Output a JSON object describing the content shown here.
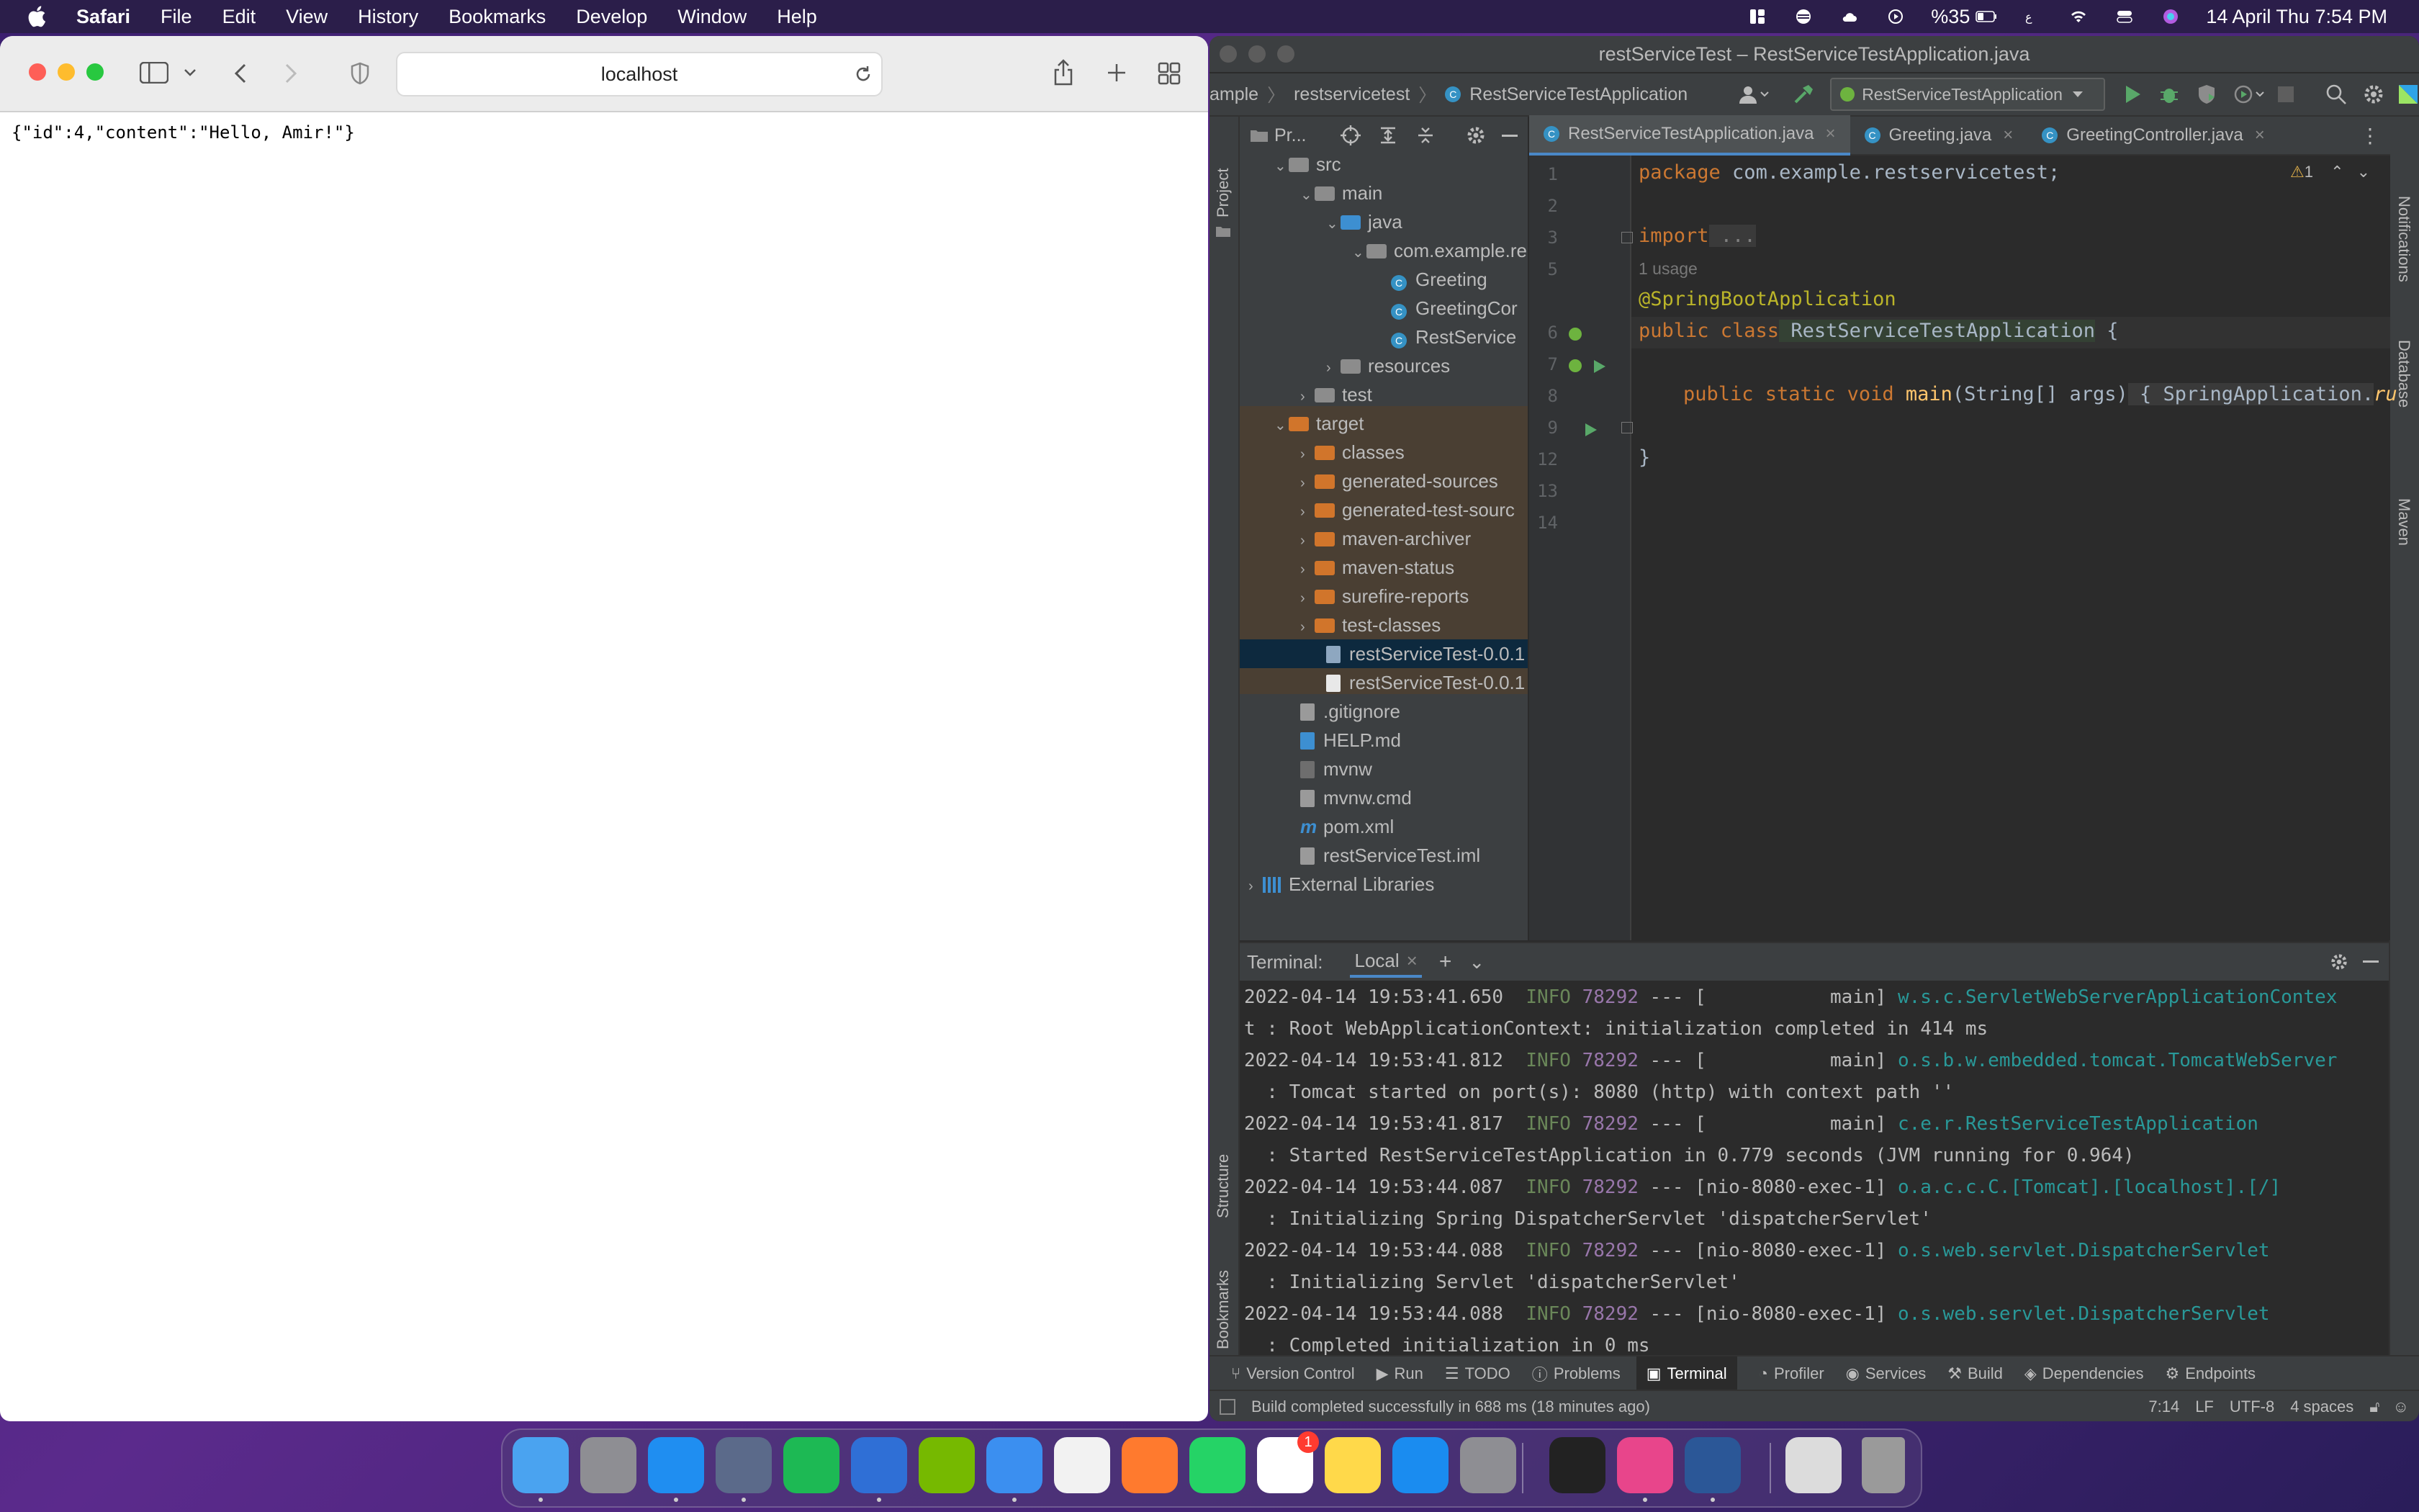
{
  "menubar": {
    "app": "Safari",
    "items": [
      "File",
      "Edit",
      "View",
      "History",
      "Bookmarks",
      "Develop",
      "Window",
      "Help"
    ],
    "battery": "%35",
    "clock": "14 April Thu  7:54 PM"
  },
  "safari": {
    "url": "localhost",
    "content": "{\"id\":4,\"content\":\"Hello, Amir!\"}"
  },
  "ide": {
    "window_title": "restServiceTest – RestServiceTestApplication.java",
    "breadcrumb": [
      "ample",
      "restservicetest",
      "RestServiceTestApplication"
    ],
    "run_config": "RestServiceTestApplication",
    "project_label": "Pr...",
    "left_strip": [
      "Project",
      "Structure",
      "Bookmarks"
    ],
    "right_strip": [
      "Notifications",
      "Database",
      "Maven"
    ],
    "tree": [
      {
        "label": "src",
        "depth": 0,
        "kind": "folder",
        "open": true
      },
      {
        "label": "main",
        "depth": 1,
        "kind": "folder",
        "open": true
      },
      {
        "label": "java",
        "depth": 2,
        "kind": "folder-blue",
        "open": true
      },
      {
        "label": "com.example.re",
        "depth": 3,
        "kind": "package",
        "open": true
      },
      {
        "label": "Greeting",
        "depth": 4,
        "kind": "class"
      },
      {
        "label": "GreetingCor",
        "depth": 4,
        "kind": "class"
      },
      {
        "label": "RestService",
        "depth": 4,
        "kind": "class"
      },
      {
        "label": "resources",
        "depth": 2,
        "kind": "folder",
        "open": false
      },
      {
        "label": "test",
        "depth": 1,
        "kind": "folder",
        "open": false
      },
      {
        "label": "target",
        "depth": 0,
        "kind": "folder-orange",
        "open": true
      },
      {
        "label": "classes",
        "depth": 1,
        "kind": "folder-orange",
        "open": false
      },
      {
        "label": "generated-sources",
        "depth": 1,
        "kind": "folder-orange",
        "open": false
      },
      {
        "label": "generated-test-sourc",
        "depth": 1,
        "kind": "folder-orange",
        "open": false
      },
      {
        "label": "maven-archiver",
        "depth": 1,
        "kind": "folder-orange",
        "open": false
      },
      {
        "label": "maven-status",
        "depth": 1,
        "kind": "folder-orange",
        "open": false
      },
      {
        "label": "surefire-reports",
        "depth": 1,
        "kind": "folder-orange",
        "open": false
      },
      {
        "label": "test-classes",
        "depth": 1,
        "kind": "folder-orange",
        "open": false
      },
      {
        "label": "restServiceTest-0.0.1",
        "depth": 1,
        "kind": "jar",
        "selected": true
      },
      {
        "label": "restServiceTest-0.0.1",
        "depth": 1,
        "kind": "file"
      },
      {
        "label": ".gitignore",
        "depth": 0,
        "kind": "file"
      },
      {
        "label": "HELP.md",
        "depth": 0,
        "kind": "md"
      },
      {
        "label": "mvnw",
        "depth": 0,
        "kind": "file"
      },
      {
        "label": "mvnw.cmd",
        "depth": 0,
        "kind": "file"
      },
      {
        "label": "pom.xml",
        "depth": 0,
        "kind": "maven"
      },
      {
        "label": "restServiceTest.iml",
        "depth": 0,
        "kind": "file"
      },
      {
        "label": "External Libraries",
        "depth": -1,
        "kind": "lib",
        "open": false
      }
    ],
    "tabs": [
      "RestServiceTestApplication.java",
      "Greeting.java",
      "GreetingController.java"
    ],
    "warnings": "1",
    "code": {
      "l1_kw": "package",
      "l1_rest": " com.example.restservicetest;",
      "l3_kw": "import",
      "l3_fold": " ...",
      "usage": "1 usage",
      "l6": "@SpringBootApplication",
      "l7_kw": "public class",
      "l7_name": " RestServiceTestApplication",
      "l7_rest": " {",
      "l9_kw": "public static void",
      "l9_fn": " main",
      "l9_rest": "(String[] args)",
      "l9_fold": " { SpringApplication.",
      "l9_tail": "ru",
      "l13": "}",
      "line_numbers": [
        "1",
        "2",
        "3",
        "5",
        "6",
        "7",
        "8",
        "9",
        "12",
        "13",
        "14"
      ]
    },
    "terminal": {
      "label": "Terminal:",
      "tab": "Local",
      "lines": [
        {
          "ts": "2022-04-14 19:53:41.650",
          "lvl": "INFO",
          "pid": "78292",
          "mid": " --- [           main] ",
          "logger": "w.s.c.ServletWebServerApplicationContex"
        },
        {
          "cont": "t : Root WebApplicationContext: initialization completed in 414 ms"
        },
        {
          "ts": "2022-04-14 19:53:41.812",
          "lvl": "INFO",
          "pid": "78292",
          "mid": " --- [           main] ",
          "logger": "o.s.b.w.embedded.tomcat.TomcatWebServer"
        },
        {
          "cont": "  : Tomcat started on port(s): 8080 (http) with context path ''"
        },
        {
          "ts": "2022-04-14 19:53:41.817",
          "lvl": "INFO",
          "pid": "78292",
          "mid": " --- [           main] ",
          "logger": "c.e.r.RestServiceTestApplication"
        },
        {
          "cont": "  : Started RestServiceTestApplication in 0.779 seconds (JVM running for 0.964)"
        },
        {
          "ts": "2022-04-14 19:53:44.087",
          "lvl": "INFO",
          "pid": "78292",
          "mid": " --- [nio-8080-exec-1] ",
          "logger": "o.a.c.c.C.[Tomcat].[localhost].[/]"
        },
        {
          "cont": "  : Initializing Spring DispatcherServlet 'dispatcherServlet'"
        },
        {
          "ts": "2022-04-14 19:53:44.088",
          "lvl": "INFO",
          "pid": "78292",
          "mid": " --- [nio-8080-exec-1] ",
          "logger": "o.s.web.servlet.DispatcherServlet"
        },
        {
          "cont": "  : Initializing Servlet 'dispatcherServlet'"
        },
        {
          "ts": "2022-04-14 19:53:44.088",
          "lvl": "INFO",
          "pid": "78292",
          "mid": " --- [nio-8080-exec-1] ",
          "logger": "o.s.web.servlet.DispatcherServlet"
        },
        {
          "cont": "  : Completed initialization in 0 ms"
        }
      ]
    },
    "bottom_tools": [
      "Version Control",
      "Run",
      "TODO",
      "Problems",
      "Terminal",
      "Profiler",
      "Services",
      "Build",
      "Dependencies",
      "Endpoints"
    ],
    "status": {
      "message": "Build completed successfully in 688 ms (18 minutes ago)",
      "position": "7:14",
      "line_sep": "LF",
      "encoding": "UTF-8",
      "indent": "4 spaces"
    }
  },
  "dock": {
    "badge": "1",
    "apps": [
      "finder-icon",
      "launchpad-icon",
      "safari-icon",
      "quicktime-icon",
      "spotify-icon",
      "tasks-icon",
      "nvidia-icon",
      "mail-icon",
      "photos-icon",
      "infuse-icon",
      "whatsapp-icon",
      "reminders-icon",
      "notes-icon",
      "appstore-icon",
      "settings-icon",
      "activity-monitor-icon",
      "intellij-icon",
      "word-icon",
      "downloads-icon",
      "trash-icon"
    ],
    "colors": [
      "#4aa3f0",
      "#8e8e93",
      "#1f8ef1",
      "#5b6a8a",
      "#1db954",
      "#2f6fd6",
      "#76b900",
      "#3b8ff0",
      "#f2f2f2",
      "#ff7a2e",
      "#25d366",
      "#ffffff",
      "#ffd94a",
      "#1a8cf0",
      "#8e8e93",
      "#222222",
      "#e8458b",
      "#2b5797",
      "#dcdcdc",
      "#9a9a9a"
    ]
  }
}
